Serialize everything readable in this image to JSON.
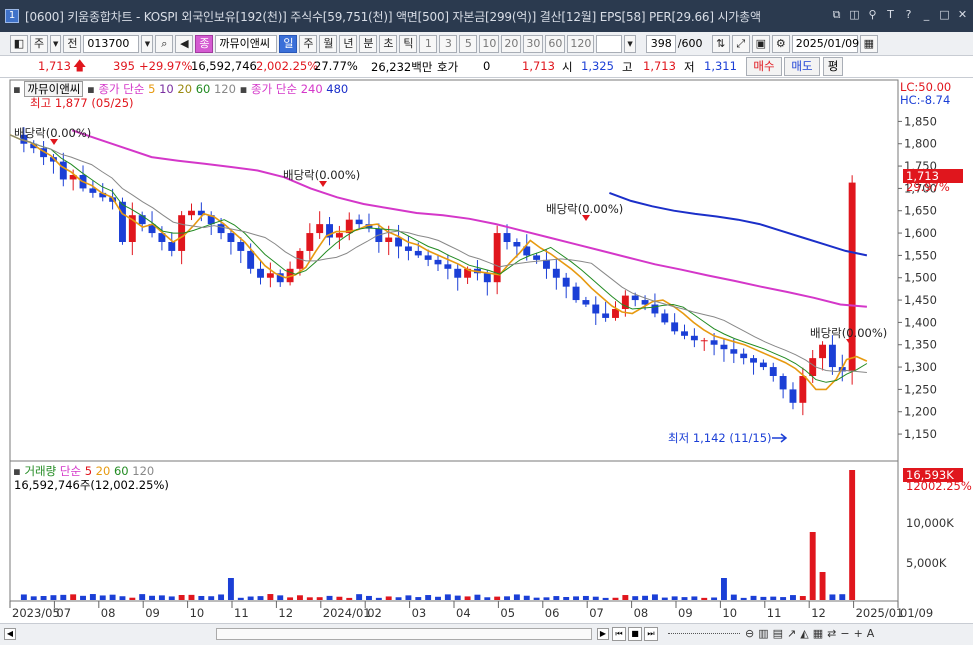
{
  "window": {
    "app_number": "1",
    "title": "[0600] 키움종합차트 - KOSPI 외국인보유[192(천)] 주식수[59,751(천)] 액면[500] 자본금[299(억)] 결산[12월] EPS[58] PER[29.66] 시가총액"
  },
  "toolbar": {
    "period_select": "주",
    "prev_label": "전",
    "stock_code": "013700",
    "stock_type_badge": "종",
    "stock_name": "까뮤이앤씨",
    "intervals": [
      "일",
      "주",
      "월",
      "년",
      "분",
      "초",
      "틱"
    ],
    "active_interval": "일",
    "minute_presets": [
      "1",
      "3",
      "5",
      "10",
      "20",
      "30",
      "60",
      "120"
    ],
    "count": "398",
    "count_total": "/600",
    "date": "2025/01/09"
  },
  "infobar": {
    "price": "1,713",
    "change": "395",
    "change_pct": "+29.97%",
    "volume": "16,592,746",
    "volume_pct": "2,002.25%",
    "turnover": "27.77%",
    "amount": "26,232백만",
    "quote_label": "호가",
    "quote_value": "0",
    "current": "1,713",
    "open_label": "시",
    "open": "1,325",
    "high_label": "고",
    "high": "1,713",
    "low_label": "저",
    "low": "1,311",
    "buy_label": "매수",
    "sell_label": "매도",
    "avg_label": "평"
  },
  "price_panel": {
    "stock_label": "까뮤이앤씨",
    "ma_short_label": "종가 단순",
    "ma_short_periods": [
      "5",
      "10",
      "20",
      "60",
      "120"
    ],
    "ma_long_label": "종가 단순",
    "ma_long_periods": [
      "240",
      "480"
    ],
    "high_note": "최고 1,877 (05/25)",
    "low_note": "최저 1,142 (11/15)",
    "lc_label": "LC:50.00",
    "hc_label": "HC:-8.74",
    "current_tag": "1,713",
    "current_pct_tag": "29.97%",
    "dividend_notes": [
      "배당락(0.00%)",
      "배당락(0.00%)",
      "배당락(0.00%)",
      "배당락(0.00%)"
    ]
  },
  "volume_panel": {
    "label": "거래량",
    "ma_label": "단순",
    "ma_periods": [
      "5",
      "20",
      "60",
      "120"
    ],
    "current_text": "16,592,746주(12,002.25%)",
    "tag": "16,593K",
    "tag_pct": "12002.25%",
    "y_labels": [
      "10,000K",
      "5,000K"
    ]
  },
  "colors": {
    "up": "#e0161d",
    "down": "#1b3fd6",
    "ma5": "#e79a10",
    "ma10": "#7a2fa0",
    "ma20": "#9a8a10",
    "ma60": "#228b22",
    "ma120": "#888888",
    "ma240": "#d437c9",
    "ma480": "#1b2fc9"
  },
  "chart_data": {
    "type": "candlestick",
    "y_axis_labels": [
      "1,850",
      "1,800",
      "1,750",
      "1,700",
      "1,650",
      "1,600",
      "1,550",
      "1,500",
      "1,450",
      "1,400",
      "1,350",
      "1,300",
      "1,250",
      "1,200",
      "1,150"
    ],
    "ylim": [
      1130,
      1880
    ],
    "x_axis_labels": [
      "2023/05",
      "07",
      "08",
      "09",
      "10",
      "11",
      "12",
      "2024/01",
      "02",
      "03",
      "04",
      "05",
      "06",
      "07",
      "08",
      "09",
      "10",
      "11",
      "12",
      "2025/01",
      "01/09"
    ],
    "close_path": [
      1820,
      1800,
      1790,
      1770,
      1760,
      1720,
      1730,
      1700,
      1690,
      1680,
      1670,
      1580,
      1640,
      1620,
      1600,
      1580,
      1560,
      1640,
      1650,
      1640,
      1620,
      1600,
      1580,
      1560,
      1520,
      1500,
      1510,
      1490,
      1520,
      1560,
      1600,
      1620,
      1590,
      1600,
      1630,
      1620,
      1610,
      1580,
      1590,
      1570,
      1560,
      1550,
      1540,
      1530,
      1520,
      1500,
      1520,
      1510,
      1490,
      1600,
      1580,
      1570,
      1550,
      1540,
      1520,
      1500,
      1480,
      1450,
      1440,
      1420,
      1410,
      1430,
      1460,
      1450,
      1440,
      1420,
      1400,
      1380,
      1370,
      1360,
      1360,
      1350,
      1340,
      1330,
      1320,
      1310,
      1300,
      1280,
      1250,
      1220,
      1280,
      1320,
      1350,
      1300,
      1290,
      1713
    ],
    "ma240_path": [
      1830,
      1810,
      1790,
      1770,
      1762,
      1755,
      1748,
      1740,
      1725,
      1700,
      1680,
      1665,
      1655,
      1645,
      1640,
      1632,
      1620,
      1605,
      1590,
      1575,
      1560,
      1545,
      1530,
      1518,
      1505,
      1493,
      1480,
      1468,
      1455,
      1440,
      1435
    ],
    "ma480_path": [
      1690,
      1672,
      1660,
      1650,
      1643,
      1637,
      1630,
      1620,
      1605,
      1590,
      1575,
      1560,
      1550
    ]
  }
}
